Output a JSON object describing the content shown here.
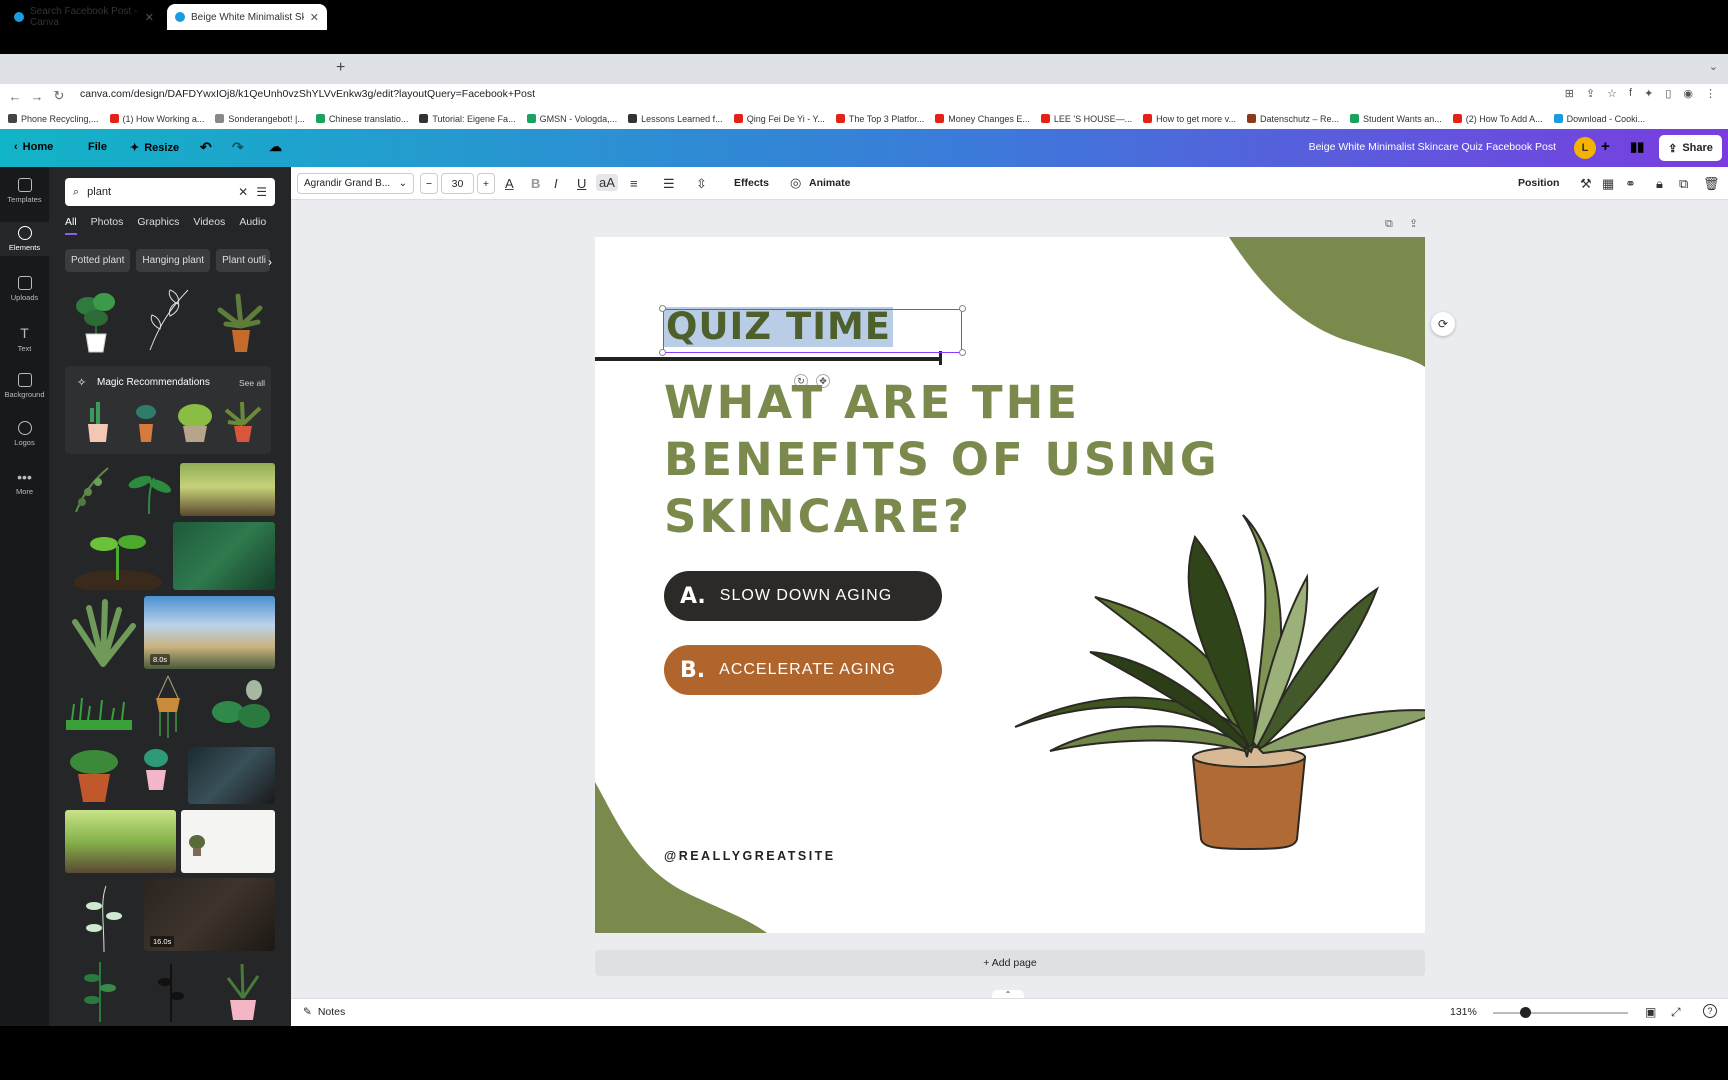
{
  "browser": {
    "tabs": [
      {
        "title": "Search Facebook Post - Canva"
      },
      {
        "title": "Beige White Minimalist Skinca"
      }
    ],
    "url": "canva.com/design/DAFDYwxIOj8/k1QeUnh0vzShYLVvEnkw3g/edit?layoutQuery=Facebook+Post",
    "bookmarks": [
      {
        "label": "Phone Recycling,...",
        "color": "#444"
      },
      {
        "label": "(1) How Working a...",
        "color": "#e62117"
      },
      {
        "label": "Sonderangebot! |...",
        "color": "#888"
      },
      {
        "label": "Chinese translatio...",
        "color": "#1aa260"
      },
      {
        "label": "Tutorial: Eigene Fa...",
        "color": "#333"
      },
      {
        "label": "GMSN - Vologda,...",
        "color": "#1aa260"
      },
      {
        "label": "Lessons Learned f...",
        "color": "#333"
      },
      {
        "label": "Qing Fei De Yi - Y...",
        "color": "#e62117"
      },
      {
        "label": "The Top 3 Platfor...",
        "color": "#e62117"
      },
      {
        "label": "Money Changes E...",
        "color": "#e62117"
      },
      {
        "label": "LEE 'S HOUSE—...",
        "color": "#e62117"
      },
      {
        "label": "How to get more v...",
        "color": "#e62117"
      },
      {
        "label": "Datenschutz – Re...",
        "color": "#8a3a1a"
      },
      {
        "label": "Student Wants an...",
        "color": "#1aa260"
      },
      {
        "label": "(2) How To Add A...",
        "color": "#e62117"
      },
      {
        "label": "Download - Cooki...",
        "color": "#1b9ce0"
      }
    ]
  },
  "header": {
    "home": "Home",
    "file": "File",
    "resize": "Resize",
    "design_title": "Beige White Minimalist Skincare Quiz Facebook Post",
    "avatar_initial": "L",
    "share": "Share"
  },
  "rail": [
    {
      "label": "Templates"
    },
    {
      "label": "Elements"
    },
    {
      "label": "Uploads"
    },
    {
      "label": "Text"
    },
    {
      "label": "Background"
    },
    {
      "label": "Logos"
    },
    {
      "label": "More"
    }
  ],
  "panel": {
    "search_value": "plant",
    "tabs": [
      "All",
      "Photos",
      "Graphics",
      "Videos",
      "Audio"
    ],
    "chips": [
      "Potted plant",
      "Hanging plant",
      "Plant outli"
    ],
    "magic_title": "Magic Recommendations",
    "magic_see_all": "See all",
    "video_durations": [
      "8.0s",
      "16.0s"
    ]
  },
  "toolbar": {
    "font": "Agrandir Grand B...",
    "font_size": "30",
    "effects": "Effects",
    "animate": "Animate",
    "position": "Position"
  },
  "design": {
    "quiz_title": "QUIZ TIME",
    "question": "WHAT ARE THE BENEFITS OF USING SKINCARE?",
    "answer_a_letter": "A.",
    "answer_a": "SLOW DOWN AGING",
    "answer b_letter": "B.",
    "answer_b_letter": "B.",
    "answer_b": "ACCELERATE AGING",
    "site": "@REALLYGREATSITE",
    "colors": {
      "olive": "#7a8a4c",
      "dark": "#2b2a27",
      "rust": "#b0652c",
      "title": "#4d5f2a"
    }
  },
  "editor": {
    "add_page": "+ Add page",
    "notes": "Notes",
    "zoom": "131%"
  }
}
